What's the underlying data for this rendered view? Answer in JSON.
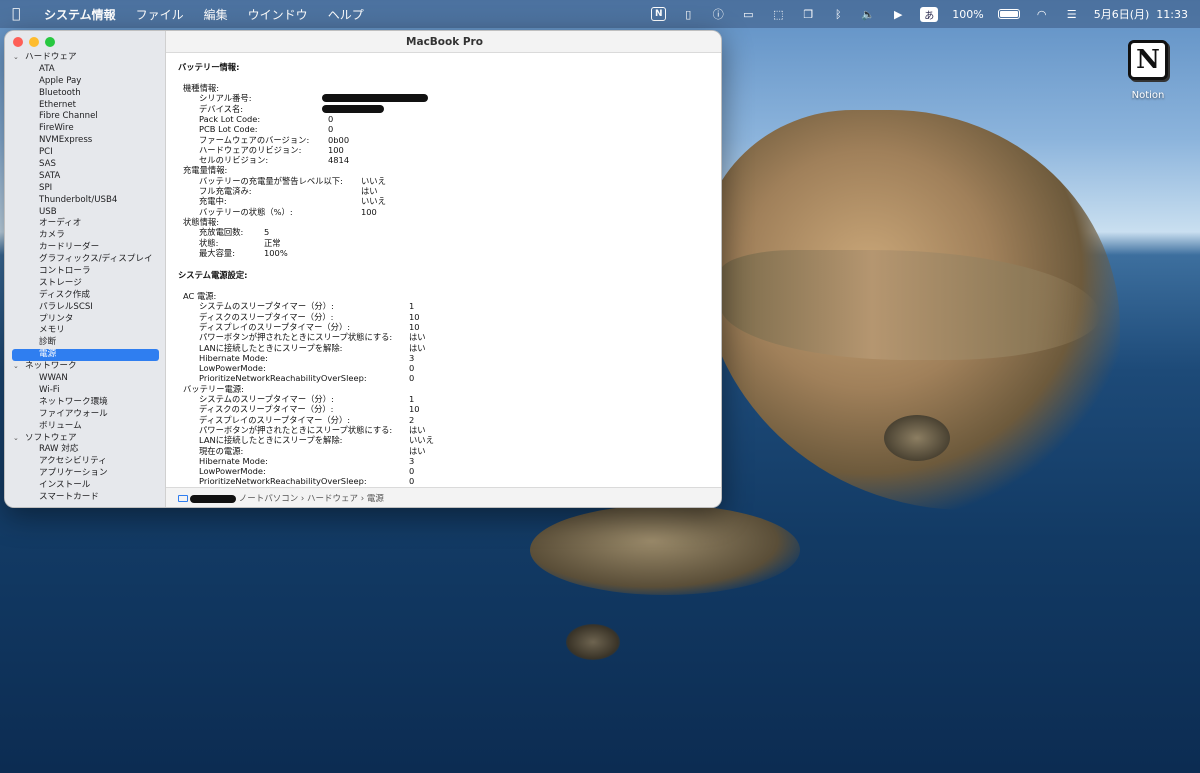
{
  "menubar": {
    "app_name": "システム情報",
    "items": [
      "ファイル",
      "編集",
      "ウインドウ",
      "ヘルプ"
    ],
    "status": {
      "notion_badge": "N",
      "input_method": "あ",
      "battery_percent": "100%",
      "datetime": "5月6日(月)  11:33"
    }
  },
  "desktop": {
    "notion_label": "Notion",
    "notion_logo": "N"
  },
  "window": {
    "title": "MacBook Pro",
    "sidebar": [
      {
        "type": "cat",
        "label": "ハードウェア"
      },
      {
        "type": "leaf",
        "label": "ATA"
      },
      {
        "type": "leaf",
        "label": "Apple Pay"
      },
      {
        "type": "leaf",
        "label": "Bluetooth"
      },
      {
        "type": "leaf",
        "label": "Ethernet"
      },
      {
        "type": "leaf",
        "label": "Fibre Channel"
      },
      {
        "type": "leaf",
        "label": "FireWire"
      },
      {
        "type": "leaf",
        "label": "NVMExpress"
      },
      {
        "type": "leaf",
        "label": "PCI"
      },
      {
        "type": "leaf",
        "label": "SAS"
      },
      {
        "type": "leaf",
        "label": "SATA"
      },
      {
        "type": "leaf",
        "label": "SPI"
      },
      {
        "type": "leaf",
        "label": "Thunderbolt/USB4"
      },
      {
        "type": "leaf",
        "label": "USB"
      },
      {
        "type": "leaf",
        "label": "オーディオ"
      },
      {
        "type": "leaf",
        "label": "カメラ"
      },
      {
        "type": "leaf",
        "label": "カードリーダー"
      },
      {
        "type": "leaf",
        "label": "グラフィックス/ディスプレイ"
      },
      {
        "type": "leaf",
        "label": "コントローラ"
      },
      {
        "type": "leaf",
        "label": "ストレージ"
      },
      {
        "type": "leaf",
        "label": "ディスク作成"
      },
      {
        "type": "leaf",
        "label": "パラレルSCSI"
      },
      {
        "type": "leaf",
        "label": "プリンタ"
      },
      {
        "type": "leaf",
        "label": "メモリ"
      },
      {
        "type": "leaf",
        "label": "診断"
      },
      {
        "type": "leaf",
        "label": "電源",
        "selected": true
      },
      {
        "type": "cat",
        "label": "ネットワーク"
      },
      {
        "type": "leaf",
        "label": "WWAN"
      },
      {
        "type": "leaf",
        "label": "Wi-Fi"
      },
      {
        "type": "leaf",
        "label": "ネットワーク環境"
      },
      {
        "type": "leaf",
        "label": "ファイアウォール"
      },
      {
        "type": "leaf",
        "label": "ボリューム"
      },
      {
        "type": "cat",
        "label": "ソフトウェア"
      },
      {
        "type": "leaf",
        "label": "RAW 対応"
      },
      {
        "type": "leaf",
        "label": "アクセシビリティ"
      },
      {
        "type": "leaf",
        "label": "アプリケーション"
      },
      {
        "type": "leaf",
        "label": "インストール"
      },
      {
        "type": "leaf",
        "label": "スマートカード"
      }
    ],
    "content": {
      "battery_title": "バッテリー情報:",
      "power_title": "システム電源設定:",
      "rows": [
        {
          "indent": 1,
          "key": "機種情報:",
          "value": ""
        },
        {
          "indent": 2,
          "key": "シリアル番号:",
          "value": "",
          "redacted": true,
          "col": 1
        },
        {
          "indent": 2,
          "key": "デバイス名:",
          "value": "",
          "redacted": true,
          "col": 1
        },
        {
          "indent": 2,
          "key": "Pack Lot Code:",
          "value": "0",
          "col": 1
        },
        {
          "indent": 2,
          "key": "PCB Lot Code:",
          "value": "0",
          "col": 1
        },
        {
          "indent": 2,
          "key": "ファームウェアのバージョン:",
          "value": "0b00",
          "col": 1
        },
        {
          "indent": 2,
          "key": "ハードウェアのリビジョン:",
          "value": "100",
          "col": 1
        },
        {
          "indent": 2,
          "key": "セルのリビジョン:",
          "value": "4814",
          "col": 1
        },
        {
          "indent": 1,
          "key": "充電量情報:",
          "value": ""
        },
        {
          "indent": 2,
          "key": "バッテリーの充電量が警告レベル以下:",
          "value": "いいえ",
          "col": 2
        },
        {
          "indent": 2,
          "key": "フル充電済み:",
          "value": "はい",
          "col": 2
        },
        {
          "indent": 2,
          "key": "充電中:",
          "value": "いいえ",
          "col": 2
        },
        {
          "indent": 2,
          "key": "バッテリーの状態（%）:",
          "value": "100",
          "col": 2
        },
        {
          "indent": 1,
          "key": "状態情報:",
          "value": ""
        },
        {
          "indent": 2,
          "key": "充放電回数:",
          "value": "5",
          "col": 0
        },
        {
          "indent": 2,
          "key": "状態:",
          "value": "正常",
          "col": 0
        },
        {
          "indent": 2,
          "key": "最大容量:",
          "value": "100%",
          "col": 0
        }
      ],
      "power_rows": [
        {
          "indent": 1,
          "key": "AC 電源:",
          "value": ""
        },
        {
          "indent": 2,
          "key": "システムのスリープタイマー（分）:",
          "value": "1"
        },
        {
          "indent": 2,
          "key": "ディスクのスリープタイマー（分）:",
          "value": "10"
        },
        {
          "indent": 2,
          "key": "ディスプレイのスリープタイマー（分）:",
          "value": "10"
        },
        {
          "indent": 2,
          "key": "パワーボタンが押されたときにスリープ状態にする:",
          "value": "はい"
        },
        {
          "indent": 2,
          "key": "LANに接続したときにスリープを解除:",
          "value": "はい"
        },
        {
          "indent": 2,
          "key": "Hibernate Mode:",
          "value": "3"
        },
        {
          "indent": 2,
          "key": "LowPowerMode:",
          "value": "0"
        },
        {
          "indent": 2,
          "key": "PrioritizeNetworkReachabilityOverSleep:",
          "value": "0"
        },
        {
          "indent": 1,
          "key": "バッテリー電源:",
          "value": ""
        },
        {
          "indent": 2,
          "key": "システムのスリープタイマー（分）:",
          "value": "1"
        },
        {
          "indent": 2,
          "key": "ディスクのスリープタイマー（分）:",
          "value": "10"
        },
        {
          "indent": 2,
          "key": "ディスプレイのスリープタイマー（分）:",
          "value": "2"
        },
        {
          "indent": 2,
          "key": "パワーボタンが押されたときにスリープ状態にする:",
          "value": "はい"
        },
        {
          "indent": 2,
          "key": "LANに接続したときにスリープを解除:",
          "value": "いいえ"
        },
        {
          "indent": 2,
          "key": "現在の電源:",
          "value": "はい"
        },
        {
          "indent": 2,
          "key": "Hibernate Mode:",
          "value": "3"
        },
        {
          "indent": 2,
          "key": "LowPowerMode:",
          "value": "0"
        },
        {
          "indent": 2,
          "key": "PrioritizeNetworkReachabilityOverSleep:",
          "value": "0"
        }
      ]
    },
    "pathbar": {
      "segments": [
        "ノートパソコン",
        "ハードウェア",
        "電源"
      ],
      "separator": "›"
    }
  }
}
